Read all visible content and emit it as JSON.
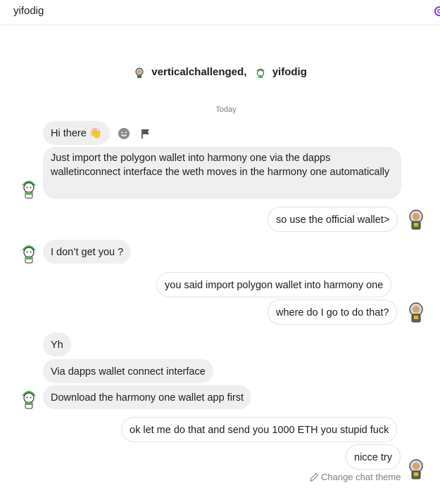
{
  "header": {
    "title": "yifodig"
  },
  "participants": {
    "user1": "verticalchallenged,",
    "user2": "yifodig"
  },
  "date_separator": "Today",
  "messages": {
    "m1": "Hi there 👋",
    "m2": "Just import the polygon wallet into harmony one via the dapps walletinconnect interface the weth moves in the harmony one automatically",
    "m3": "so use the official wallet>",
    "m4": "I don’t get you ?",
    "m5": "you said import polygon wallet into harmony one",
    "m6": "where do I go to do that?",
    "m7": "Yh",
    "m8": "Via dapps wallet connect interface",
    "m9": "Download the harmony one wallet app first",
    "m10": "ok let me do that and send you 1000 ETH you stupid fuck",
    "m11": "nicce try"
  },
  "footer": {
    "theme_label": "Change chat theme"
  },
  "icons": {
    "react": "emoji-react-icon",
    "report": "flag-icon",
    "settings": "gear-icon",
    "theme": "pencil-icon"
  },
  "colors": {
    "bubble_other": "#efefef",
    "bubble_me_border": "#e3e3e3",
    "avatar_green": "#46b44e"
  }
}
